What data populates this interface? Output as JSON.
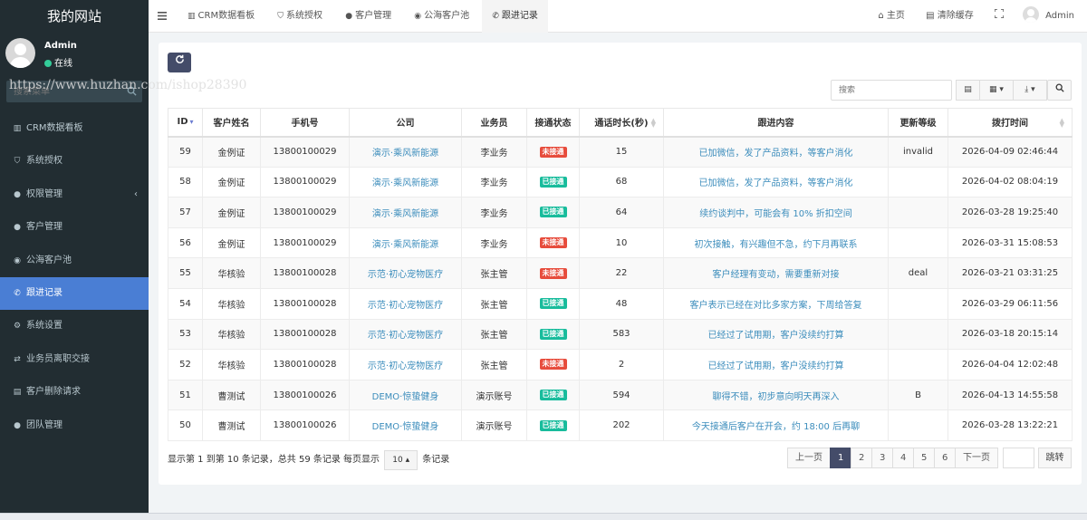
{
  "sidebar": {
    "brand": "我的网站",
    "user": {
      "name": "Admin",
      "status": "在线"
    },
    "search_placeholder": "搜索菜单",
    "watermark": "https://www.huzhan.com/ishop28390",
    "items": [
      {
        "label": "CRM数据看板",
        "icon": "bar-chart-icon"
      },
      {
        "label": "系统授权",
        "icon": "shield-icon"
      },
      {
        "label": "权限管理",
        "icon": "users-icon"
      },
      {
        "label": "客户管理",
        "icon": "users-icon"
      },
      {
        "label": "公海客户池",
        "icon": "globe-icon"
      },
      {
        "label": "跟进记录",
        "icon": "phone-icon"
      },
      {
        "label": "系统设置",
        "icon": "gears-icon"
      },
      {
        "label": "业务员离职交接",
        "icon": "exchange-icon"
      },
      {
        "label": "客户删除请求",
        "icon": "trash-icon"
      },
      {
        "label": "团队管理",
        "icon": "users-icon"
      }
    ]
  },
  "navbar": {
    "tabs": [
      "CRM数据看板",
      "系统授权",
      "客户管理",
      "公海客户池",
      "跟进记录"
    ],
    "home": "主页",
    "clear_cache": "清除缓存",
    "user": "Admin"
  },
  "search_placeholder": "搜索",
  "table": {
    "headers": [
      "ID",
      "客户姓名",
      "手机号",
      "公司",
      "业务员",
      "接通状态",
      "通话时长(秒)",
      "跟进内容",
      "更新等级",
      "拨打时间"
    ],
    "rows": [
      {
        "id": "59",
        "name": "金例证",
        "phone": "13800100029",
        "company": "演示·乘风新能源",
        "rep": "李业务",
        "status": "未接通",
        "duration": "15",
        "content": "已加微信，发了产品资料，等客户消化",
        "level": "invalid",
        "time": "2026-04-09 02:46:44"
      },
      {
        "id": "58",
        "name": "金例证",
        "phone": "13800100029",
        "company": "演示·乘风新能源",
        "rep": "李业务",
        "status": "已接通",
        "duration": "68",
        "content": "已加微信，发了产品资料，等客户消化",
        "level": "",
        "time": "2026-04-02 08:04:19"
      },
      {
        "id": "57",
        "name": "金例证",
        "phone": "13800100029",
        "company": "演示·乘风新能源",
        "rep": "李业务",
        "status": "已接通",
        "duration": "64",
        "content": "续约谈判中，可能会有 10% 折扣空间",
        "level": "",
        "time": "2026-03-28 19:25:40"
      },
      {
        "id": "56",
        "name": "金例证",
        "phone": "13800100029",
        "company": "演示·乘风新能源",
        "rep": "李业务",
        "status": "未接通",
        "duration": "10",
        "content": "初次接触，有兴趣但不急，约下月再联系",
        "level": "",
        "time": "2026-03-31 15:08:53"
      },
      {
        "id": "55",
        "name": "华核验",
        "phone": "13800100028",
        "company": "示范·初心宠物医疗",
        "rep": "张主管",
        "status": "未接通",
        "duration": "22",
        "content": "客户经理有变动，需要重新对接",
        "level": "deal",
        "time": "2026-03-21 03:31:25"
      },
      {
        "id": "54",
        "name": "华核验",
        "phone": "13800100028",
        "company": "示范·初心宠物医疗",
        "rep": "张主管",
        "status": "已接通",
        "duration": "48",
        "content": "客户表示已经在对比多家方案，下周给答复",
        "level": "",
        "time": "2026-03-29 06:11:56"
      },
      {
        "id": "53",
        "name": "华核验",
        "phone": "13800100028",
        "company": "示范·初心宠物医疗",
        "rep": "张主管",
        "status": "已接通",
        "duration": "583",
        "content": "已经过了试用期，客户没续约打算",
        "level": "",
        "time": "2026-03-18 20:15:14"
      },
      {
        "id": "52",
        "name": "华核验",
        "phone": "13800100028",
        "company": "示范·初心宠物医疗",
        "rep": "张主管",
        "status": "未接通",
        "duration": "2",
        "content": "已经过了试用期，客户没续约打算",
        "level": "",
        "time": "2026-04-04 12:02:48"
      },
      {
        "id": "51",
        "name": "曹测试",
        "phone": "13800100026",
        "company": "DEMO·惊蛰健身",
        "rep": "演示账号",
        "status": "已接通",
        "duration": "594",
        "content": "聊得不错，初步意向明天再深入",
        "level": "B",
        "time": "2026-04-13 14:55:58"
      },
      {
        "id": "50",
        "name": "曹测试",
        "phone": "13800100026",
        "company": "DEMO·惊蛰健身",
        "rep": "演示账号",
        "status": "已接通",
        "duration": "202",
        "content": "今天接通后客户在开会，约 18:00 后再聊",
        "level": "",
        "time": "2026-03-28 13:22:21"
      }
    ]
  },
  "pager": {
    "info_prefix": "显示第 1 到第 10 条记录，总共 59 条记录 每页显示",
    "page_size": "10",
    "info_suffix": "条记录",
    "prev": "上一页",
    "pages": [
      "1",
      "2",
      "3",
      "4",
      "5",
      "6"
    ],
    "next": "下一页",
    "jump": "跳转"
  },
  "colors": {
    "sidebar": "#222d32",
    "active": "#4a7ed4",
    "primary_btn": "#444c69",
    "badge_red": "#e74c3c",
    "badge_green": "#18bc9c",
    "link": "#3c8dbc"
  }
}
